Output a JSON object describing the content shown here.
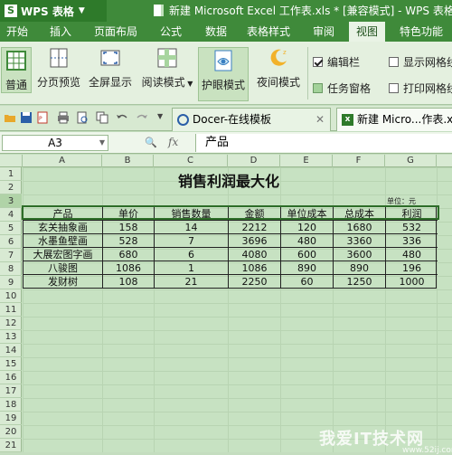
{
  "app": {
    "logo_mark": "S",
    "name": "WPS 表格",
    "title": "新建 Microsoft Excel 工作表.xls * [兼容模式] - WPS 表格"
  },
  "menu": [
    "开始",
    "插入",
    "页面布局",
    "公式",
    "数据",
    "表格样式",
    "审阅",
    "视图",
    "特色功能"
  ],
  "active_menu": "视图",
  "ribbon": {
    "buttons": [
      "普通",
      "分页预览",
      "全屏显示",
      "阅读模式",
      "护眼模式",
      "夜间模式"
    ],
    "selected": [
      "普通",
      "护眼模式"
    ],
    "checks": [
      {
        "label": "编辑栏",
        "state": "checked"
      },
      {
        "label": "显示网格线",
        "state": "unchecked"
      },
      {
        "label": "任务窗格",
        "state": "filled"
      },
      {
        "label": "打印网格线",
        "state": "unchecked"
      }
    ]
  },
  "tabs": [
    {
      "label": "Docer-在线模板",
      "icon": "docer-icon"
    },
    {
      "label": "新建 Micro...作表.xls",
      "icon": "xls-icon"
    }
  ],
  "formula_bar": {
    "name_box": "A3",
    "fx": "fx",
    "value": "产品"
  },
  "columns": [
    "A",
    "B",
    "C",
    "D",
    "E",
    "F",
    "G"
  ],
  "rows": [
    "1",
    "2",
    "3",
    "4",
    "5",
    "6",
    "7",
    "8",
    "9",
    "10",
    "11",
    "12",
    "13",
    "14",
    "15",
    "16",
    "17",
    "18",
    "19",
    "20",
    "21"
  ],
  "selected_row": "3",
  "sheet": {
    "title": "销售利润最大化",
    "unit_label": "单位：元",
    "headers": [
      "产品",
      "单价",
      "销售数量",
      "金额",
      "单位成本",
      "总成本",
      "利润"
    ],
    "rows": [
      [
        "玄关抽象画",
        "158",
        "14",
        "2212",
        "120",
        "1680",
        "532"
      ],
      [
        "水墨鱼壁画",
        "528",
        "7",
        "3696",
        "480",
        "3360",
        "336"
      ],
      [
        "大展宏图字画",
        "680",
        "6",
        "4080",
        "600",
        "3600",
        "480"
      ],
      [
        "八骏图",
        "1086",
        "1",
        "1086",
        "890",
        "890",
        "196"
      ],
      [
        "发财树",
        "108",
        "21",
        "2250",
        "60",
        "1250",
        "1000"
      ]
    ]
  },
  "watermark": {
    "text": "我爱IT技术网",
    "url": "www.52ij.com"
  },
  "colors": {
    "accent": "#3f8a3a",
    "sheet_bg": "#c7e2c2",
    "ribbon_bg": "#e4f0df"
  }
}
